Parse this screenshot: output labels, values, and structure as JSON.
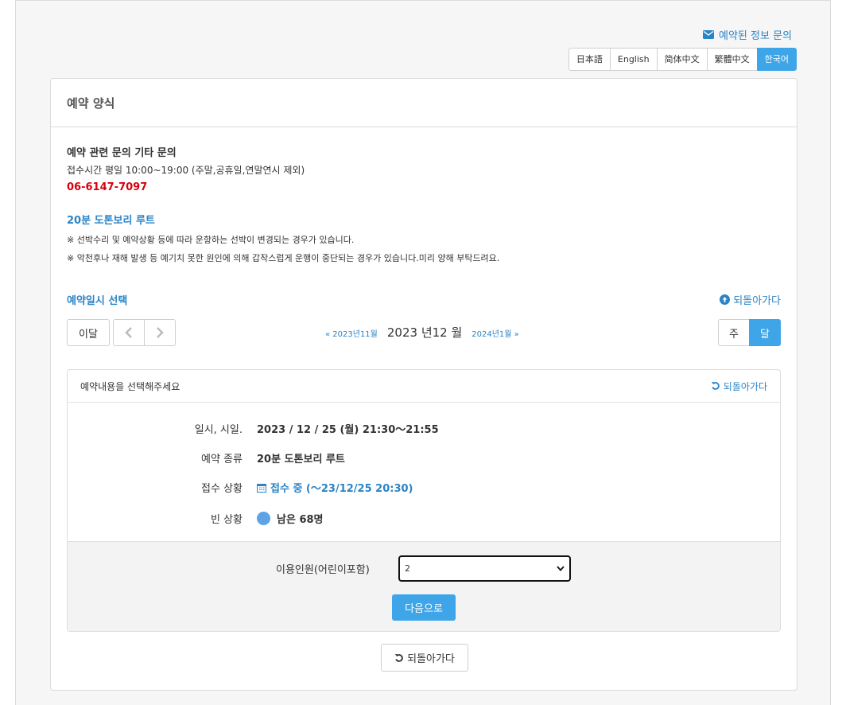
{
  "header": {
    "inquiry_link": "예약된 정보 문의",
    "languages": [
      "日本語",
      "English",
      "简体中文",
      "繁體中文",
      "한국어"
    ],
    "active_language": "한국어"
  },
  "panel": {
    "title": "예약 양식",
    "contact": {
      "title": "예약 관련 문의 기타 문의",
      "hours": "접수시간 평일 10:00~19:00 (주말,공휴일,연말연시 제외)",
      "phone": "06-6147-7097"
    },
    "route": {
      "title": "20분 도톤보리 루트",
      "note1": "※ 선박수리 및 예약상황 등에 따라 운항하는 선박이 변경되는 경우가 있습니다.",
      "note2": "※ 악천후나 재해 발생 등 예기치 못한 원인에 의해 갑작스럽게 운행이 중단되는 경우가 있습니다.미리 양해 부탁드려요."
    },
    "calendar": {
      "section_title": "예약일시 선택",
      "back_label": "되돌아가다",
      "this_month": "이달",
      "prev_month": "« 2023년11월",
      "current_month": "2023 년12 월",
      "next_month": "2024년1월 »",
      "view_week": "주",
      "view_month": "달"
    },
    "detail": {
      "heading": "예약내용을 선택해주세요",
      "back_label": "되돌아가다",
      "rows": {
        "datetime_label": "일시, 시일.",
        "datetime_value": "2023 / 12 / 25 (월) 21:30〜21:55",
        "type_label": "예약 종류",
        "type_value": "20분 도톤보리 루트",
        "status_label": "접수 상황",
        "status_value": "접수 중 (〜23/12/25 20:30)",
        "vacancy_label": "빈 상황",
        "vacancy_value": "남은 68명"
      },
      "people_label": "이용인원(어린이포함)",
      "people_value": "2",
      "next_button": "다음으로"
    },
    "bottom_back": "되돌아가다"
  },
  "colors": {
    "accent": "#3da5e8",
    "link": "#2a84c6",
    "phone": "#d8000c",
    "vacancy_dot": "#5da3e6"
  }
}
